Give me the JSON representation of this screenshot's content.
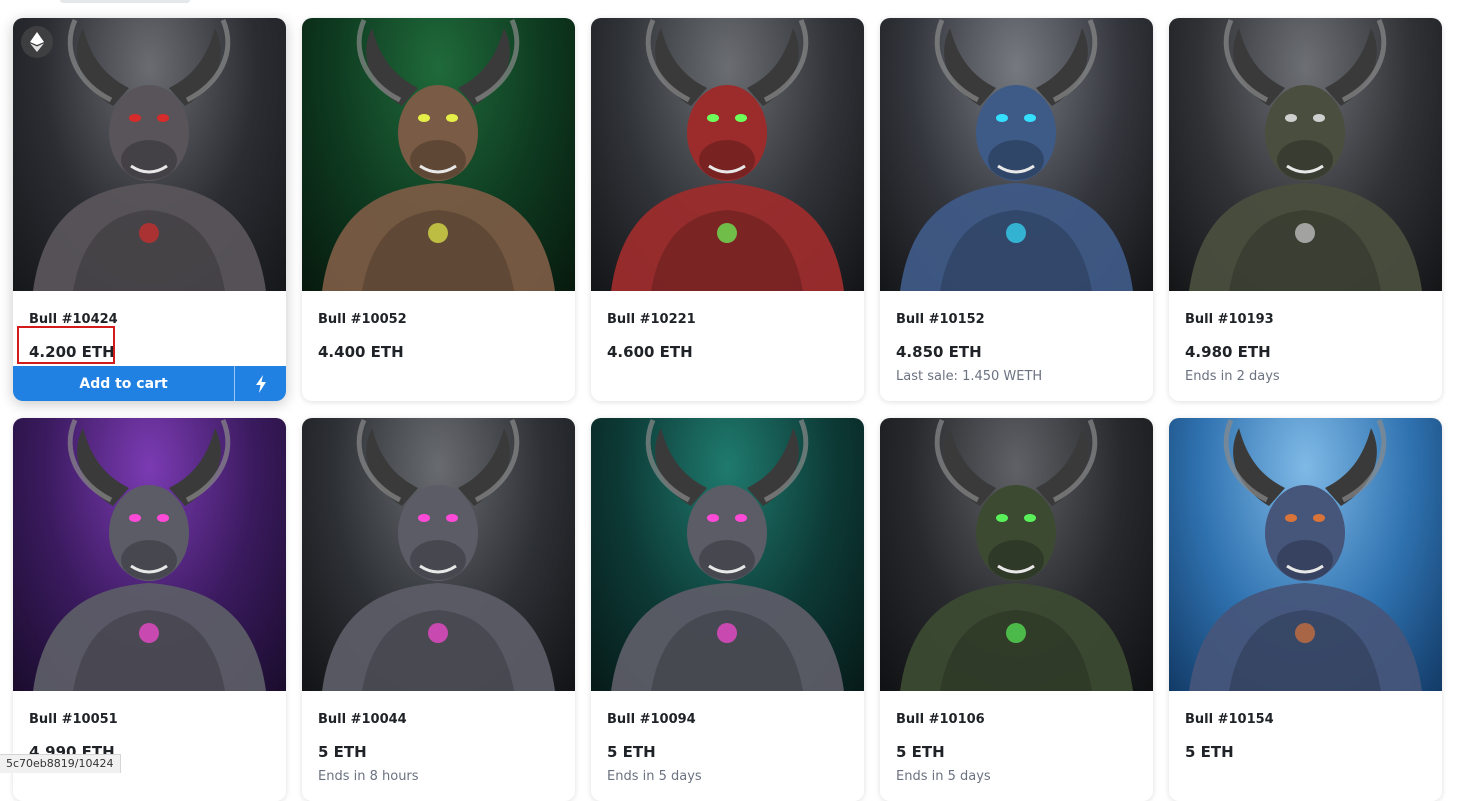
{
  "items": [
    {
      "name": "Bull #10424",
      "price": "4.200 ETH",
      "sub": "",
      "theme": [
        "#6a6c72",
        "#2b2d33",
        "#15171a"
      ],
      "figure": "#58545a",
      "accent": "#d62b2b"
    },
    {
      "name": "Bull #10052",
      "price": "4.400 ETH",
      "sub": "",
      "theme": [
        "#1f6a3a",
        "#0e3a20",
        "#07190d"
      ],
      "figure": "#7a5b45",
      "accent": "#e6ee48"
    },
    {
      "name": "Bull #10221",
      "price": "4.600 ETH",
      "sub": "",
      "theme": [
        "#6a6d72",
        "#303338",
        "#131417"
      ],
      "figure": "#9c2c2c",
      "accent": "#6dff5a"
    },
    {
      "name": "Bull #10152",
      "price": "4.850 ETH",
      "sub": "Last sale: 1.450 WETH",
      "theme": [
        "#767a80",
        "#33363c",
        "#141518"
      ],
      "figure": "#3e5a86",
      "accent": "#35e0ff"
    },
    {
      "name": "Bull #10193",
      "price": "4.980 ETH",
      "sub": "Ends in 2 days",
      "theme": [
        "#6c6f74",
        "#303236",
        "#141517"
      ],
      "figure": "#4a4e3e",
      "accent": "#cfcfcf"
    },
    {
      "name": "Bull #10051",
      "price": "4.990 ETH",
      "sub": "",
      "theme": [
        "#7b3bb3",
        "#3a1a5e",
        "#1a0c2c"
      ],
      "figure": "#5c5c66",
      "accent": "#ff4ad8"
    },
    {
      "name": "Bull #10044",
      "price": "5 ETH",
      "sub": "Ends in 8 hours",
      "theme": [
        "#686b70",
        "#2d3035",
        "#121316"
      ],
      "figure": "#5c5c66",
      "accent": "#ff4ad8"
    },
    {
      "name": "Bull #10094",
      "price": "5 ETH",
      "sub": "Ends in 5 days",
      "theme": [
        "#1f7a6e",
        "#0d3a36",
        "#061a18"
      ],
      "figure": "#5c5c66",
      "accent": "#ff4ad8"
    },
    {
      "name": "Bull #10106",
      "price": "5 ETH",
      "sub": "Ends in 5 days",
      "theme": [
        "#5f6166",
        "#27292d",
        "#101113"
      ],
      "figure": "#3c4a32",
      "accent": "#59f05a"
    },
    {
      "name": "Bull #10154",
      "price": "5 ETH",
      "sub": "",
      "theme": [
        "#7fb9e6",
        "#2f72b0",
        "#123a66"
      ],
      "figure": "#46557a",
      "accent": "#d8743a"
    }
  ],
  "active_card": {
    "add_to_cart": "Add to cart"
  },
  "statusbar": {
    "url": "5c70eb8819/10424"
  },
  "colors": {
    "primary": "#2081e2",
    "highlight": "#d41b1b"
  }
}
